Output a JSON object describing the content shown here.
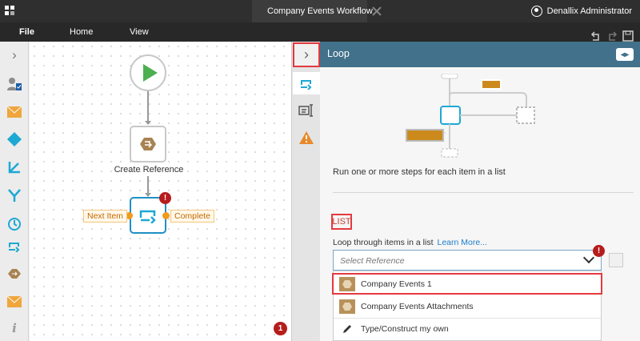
{
  "app": {
    "tab_title": "Company Events Workflow",
    "user_name": "Denallix Administrator"
  },
  "menu": {
    "file": "File",
    "home": "Home",
    "view": "View"
  },
  "toolbox": {
    "items": [
      "expand-icon",
      "user-task-icon",
      "email-icon",
      "decision-icon",
      "branch-icon",
      "merge-icon",
      "timer-icon",
      "loop-icon",
      "reference-icon",
      "email-icon",
      "info-icon"
    ]
  },
  "canvas": {
    "create_reference_label": "Create Reference",
    "next_item_label": "Next Item",
    "complete_label": "Complete",
    "loop_error": "!",
    "badge_count": "1"
  },
  "panel": {
    "title": "Loop",
    "description": "Run one or more steps for each item in a list",
    "section_heading": "LIST",
    "loop_label": "Loop through items in a list",
    "learn_more": "Learn More...",
    "select_placeholder": "Select Reference",
    "select_error": "!",
    "options": [
      {
        "label": "Company Events 1"
      },
      {
        "label": "Company Events Attachments"
      },
      {
        "label": "Type/Construct my own"
      }
    ]
  },
  "colors": {
    "accent_blue": "#42718b",
    "highlight_red": "#e53940",
    "error_red": "#b71c1c",
    "loop_blue": "#1e90c6",
    "start_green": "#4caf50",
    "pill_orange": "#f19a1b"
  }
}
